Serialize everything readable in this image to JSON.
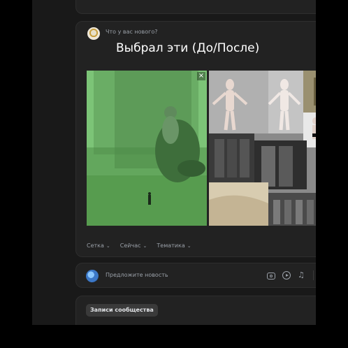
{
  "composer": {
    "prompt": "Что у вас нового?",
    "overlay_caption": "Выбрал эти (До/После)",
    "filters": [
      "Сетка",
      "Сейчас",
      "Тематика"
    ]
  },
  "suggest": {
    "placeholder": "Предложите новость"
  },
  "records": {
    "button_label": "Записи сообщества"
  },
  "icons": {
    "close": "×",
    "chevron": "⌄",
    "music": "♫"
  }
}
